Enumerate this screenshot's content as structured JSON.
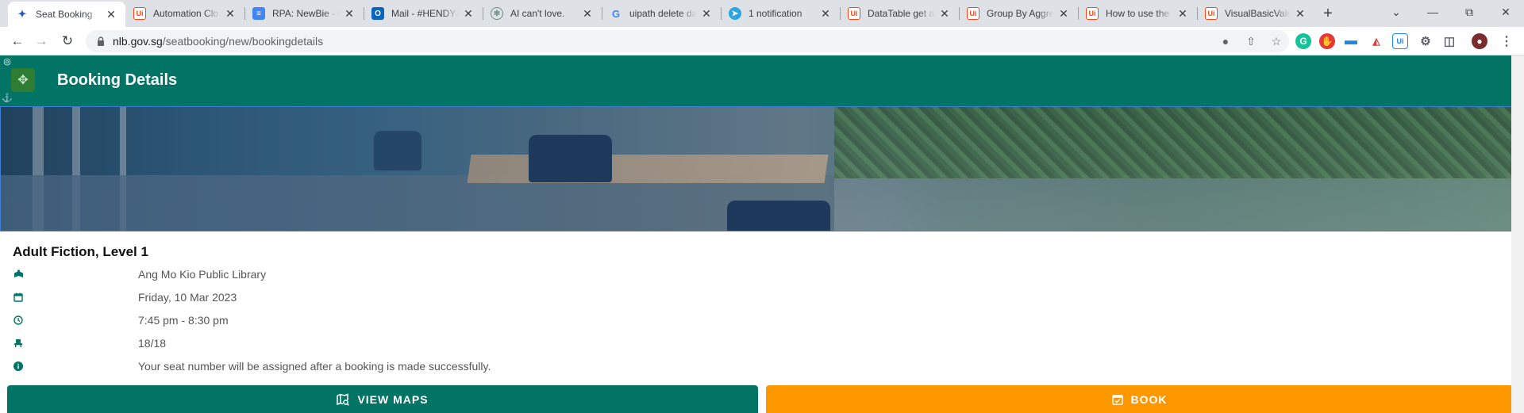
{
  "browser": {
    "tabs": [
      {
        "title": "Seat Booking",
        "favicon": "nlb-icon",
        "active": true
      },
      {
        "title": "Automation Clo",
        "favicon": "uipath-icon"
      },
      {
        "title": "RPA: NewBie - G",
        "favicon": "docs-icon"
      },
      {
        "title": "Mail - #HENDY#",
        "favicon": "outlook-icon"
      },
      {
        "title": "AI can't love.",
        "favicon": "openai-icon"
      },
      {
        "title": "uipath delete da",
        "favicon": "google-icon"
      },
      {
        "title": "1 notification",
        "favicon": "telegram-icon"
      },
      {
        "title": "DataTable get al",
        "favicon": "uipath-icon"
      },
      {
        "title": "Group By Aggre",
        "favicon": "uipath-icon"
      },
      {
        "title": "How to use the",
        "favicon": "uipath-icon"
      },
      {
        "title": "VisualBasicValu",
        "favicon": "uipath-icon"
      }
    ],
    "url_host": "nlb.gov.sg",
    "url_path": "/seatbooking/new/bookingdetails"
  },
  "page": {
    "header_title": "Booking Details",
    "location_title": "Adult Fiction, Level 1",
    "details": [
      {
        "icon": "library-icon",
        "text": "Ang Mo Kio Public Library"
      },
      {
        "icon": "calendar-icon",
        "text": "Friday, 10 Mar 2023"
      },
      {
        "icon": "clock-icon",
        "text": "7:45 pm - 8:30 pm"
      },
      {
        "icon": "seat-icon",
        "text": "18/18"
      },
      {
        "icon": "info-icon",
        "text": "Your seat number will be assigned after a booking is made successfully."
      }
    ],
    "view_maps_label": "VIEW MAPS",
    "book_label": "BOOK"
  },
  "colors": {
    "primary_teal": "#017465",
    "book_orange": "#ff9800",
    "tab_strip": "#dee1e6"
  }
}
